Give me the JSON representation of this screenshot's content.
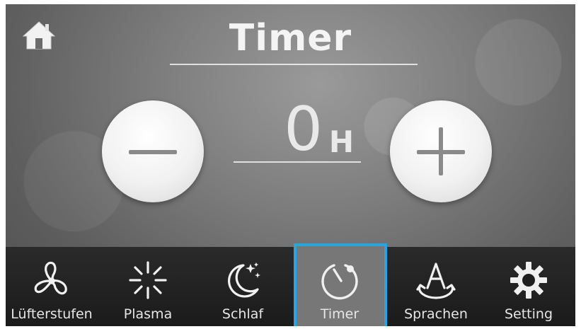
{
  "header": {
    "title": "Timer",
    "home_icon": "home-icon"
  },
  "timer": {
    "value": "0",
    "unit": "H",
    "decrement_icon": "minus-icon",
    "increment_icon": "plus-icon"
  },
  "nav": {
    "items": [
      {
        "label": "Lüfterstufen",
        "icon": "fan-icon"
      },
      {
        "label": "Plasma",
        "icon": "sparkle-icon"
      },
      {
        "label": "Schlaf",
        "icon": "moon-stars-icon"
      },
      {
        "label": "Timer",
        "icon": "timer-icon",
        "selected": true
      },
      {
        "label": "Sprachen",
        "icon": "language-icon"
      },
      {
        "label": "Setting",
        "icon": "gear-icon"
      }
    ]
  },
  "colors": {
    "selected_border": "#2aa4dc",
    "navbar_bg": "#1f1f1f",
    "button_face": "#f1f1f1"
  }
}
